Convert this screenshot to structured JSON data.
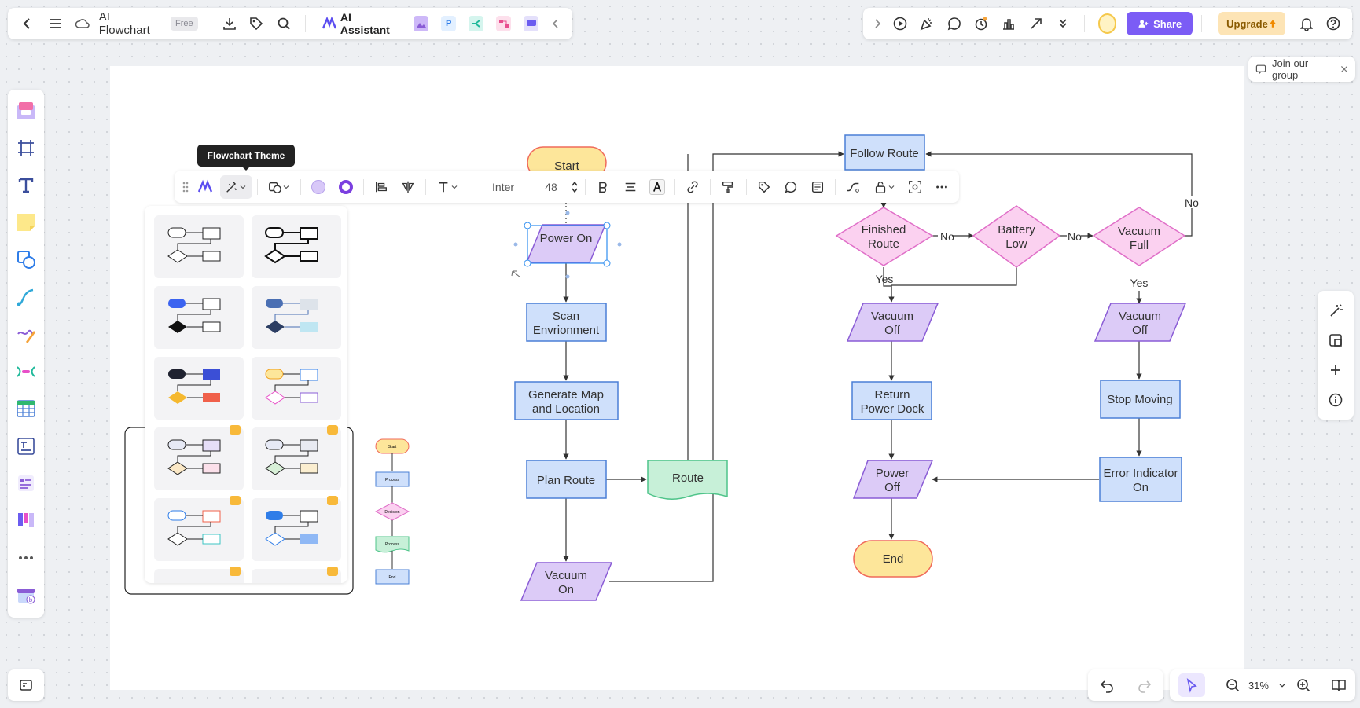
{
  "toolbar": {
    "title": "AI Flowchart",
    "plan_badge": "Free",
    "ai_assistant_label": "AI Assistant",
    "mini_app_p": "P"
  },
  "header_right": {
    "share_label": "Share",
    "upgrade_label": "Upgrade"
  },
  "join_group": {
    "label": "Join our group"
  },
  "tooltip": {
    "text": "Flowchart Theme"
  },
  "format_toolbar": {
    "font_name": "Inter",
    "font_size": "48"
  },
  "zoom": {
    "level": "31%"
  },
  "colors": {
    "accent": "#7b5cf5",
    "process_fill": "#cfe0fb",
    "process_stroke": "#4a7fd6",
    "decision_fill": "#fbd1f0",
    "decision_stroke": "#e06fc8",
    "io_fill": "#dccbf7",
    "io_stroke": "#8a5cd6",
    "terminal_fill": "#fde69a",
    "terminal_stroke": "#f06a5a",
    "document_fill": "#c7f0d8",
    "document_stroke": "#4fc48a"
  },
  "flowchart": {
    "nodes": {
      "start": "Start",
      "power_on": "Power On",
      "scan": [
        "Scan",
        "Envrionment"
      ],
      "generate_map": [
        "Generate Map",
        "and Location"
      ],
      "plan_route": "Plan Route",
      "route": "Route",
      "vacuum_on": [
        "Vacuum",
        "On"
      ],
      "follow_route": "Follow Route",
      "finished_route": [
        "Finished",
        "Route"
      ],
      "battery_low": [
        "Battery",
        "Low"
      ],
      "vacuum_full": [
        "Vacuum",
        "Full"
      ],
      "vacuum_off_1": [
        "Vacuum",
        "Off"
      ],
      "vacuum_off_2": [
        "Vacuum",
        "Off"
      ],
      "return_power_dock": [
        "Return",
        "Power Dock"
      ],
      "stop_moving": "Stop Moving",
      "power_off": [
        "Power",
        "Off"
      ],
      "error_indicator": [
        "Error Indicator",
        "On"
      ],
      "end": "End"
    },
    "edge_labels": {
      "no_1": "No",
      "no_2": "No",
      "no_3": "No",
      "yes_1": "Yes",
      "yes_2": "Yes"
    }
  },
  "mini_flowchart": {
    "start": "Start",
    "process": "Process",
    "decision": "Decision",
    "process2": "Process",
    "end": "End"
  }
}
